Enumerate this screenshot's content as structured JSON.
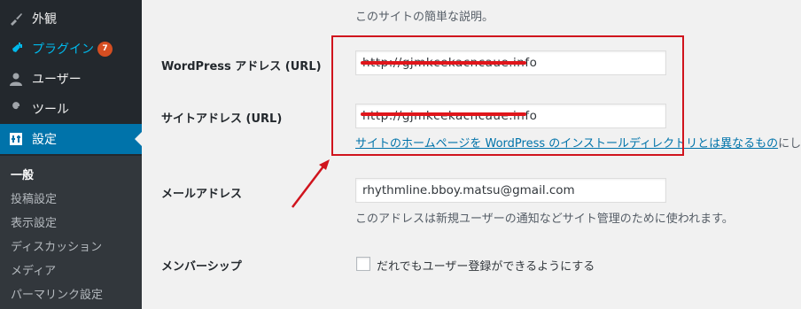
{
  "sidebar": {
    "items": [
      {
        "label": "外観",
        "icon": "brush-icon"
      },
      {
        "label": "プラグイン",
        "icon": "plugin-icon",
        "badge": "7"
      },
      {
        "label": "ユーザー",
        "icon": "user-icon"
      },
      {
        "label": "ツール",
        "icon": "wrench-icon"
      },
      {
        "label": "設定",
        "icon": "settings-icon"
      }
    ],
    "submenu": [
      "一般",
      "投稿設定",
      "表示設定",
      "ディスカッション",
      "メディア",
      "パーマリンク設定"
    ]
  },
  "form": {
    "tagline_description": "このサイトの簡単な説明。",
    "wp_address_label": "WordPress アドレス (URL)",
    "wp_address_value": "http://gjmkcekacncaue.info",
    "site_address_label": "サイトアドレス (URL)",
    "site_address_value": "http://gjmkcekacncaue.info",
    "site_address_link": "サイトのホームページを WordPress のインストールディレクトリとは異なるもの",
    "site_address_tail": "にしたい",
    "email_label": "メールアドレス",
    "email_value": "rhythmline.bboy.matsu@gmail.com",
    "email_description": "このアドレスは新規ユーザーの通知などサイト管理のために使われます。",
    "membership_label": "メンバーシップ",
    "membership_checkbox_label": "だれでもユーザー登録ができるようにする"
  },
  "colors": {
    "annotation_red": "#d0141d",
    "sidebar_bg": "#23282d",
    "active_blue": "#0073aa"
  }
}
